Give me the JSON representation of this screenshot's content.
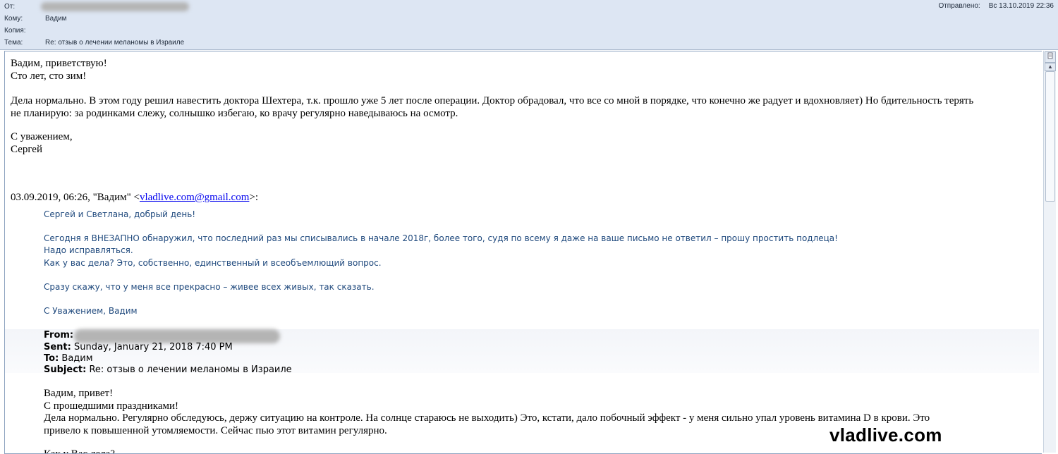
{
  "header": {
    "from_label": "От:",
    "to_label": "Кому:",
    "to_value": "Вадим",
    "cc_label": "Копия:",
    "subject_label": "Тема:",
    "subject_value": "Re: отзыв о лечении меланомы в Израиле",
    "sent_label": "Отправлено:",
    "sent_value": "Вс 13.10.2019 22:36"
  },
  "message": {
    "greeting": "Вадим, приветствую!",
    "line2": "Сто лет, сто зим!",
    "para1_line1": "Дела нормально. В этом году решил навестить доктора Шехтера, т.к. прошло уже 5 лет после операции. Доктор обрадовал, что все со мной в порядке, что конечно же радует и вдохновляет) Но бдительность терять",
    "para1_line2": "не планирую: за родинками слежу, солнышко избегаю, ко врачу регулярно наведываюсь на осмотр.",
    "closing": "С уважением,",
    "signature": "Сергей"
  },
  "quote1": {
    "header_prefix": "03.09.2019, 06:26, \"Вадим\" <",
    "header_email": "vladlive.com@gmail.com",
    "header_suffix": ">:",
    "l1": "Сергей и Светлана, добрый день!",
    "l2": "Сегодня я ВНЕЗАПНО обнаружил, что последний раз мы списывались в начале 2018г, более того, судя по всему я даже на ваше письмо не ответил – прошу простить подлеца!",
    "l3": "Надо исправляться.",
    "l4": "Как у вас дела? Это, собственно, единственный и всеобъемлющий вопрос.",
    "l5": "Сразу скажу, что у меня все прекрасно – живее всех живых, так сказать.",
    "l6": "С Уважением, Вадим"
  },
  "quote2": {
    "from_label": "From:",
    "sent_label": "Sent:",
    "sent_value": "Sunday, January 21, 2018 7:40 PM",
    "to_label": "To:",
    "to_value": "Вадим",
    "subject_label": "Subject:",
    "subject_value": "Re: отзыв о лечении меланомы в Израиле",
    "l1": "Вадим, привет!",
    "l2": "С прошедшими праздниками!",
    "l3": "Дела нормально. Регулярно обследуюсь, держу ситуацию на контроле. На солнце стараюсь не выходить) Это, кстати, дало побочный эффект - у меня сильно упал уровень витамина D в крови. Это",
    "l4": "привело к повышенной утомляемости. Сейчас пью этот витамин регулярно.",
    "l5": "Как у Вас дела?"
  },
  "watermark": "vladlive.com",
  "icons": {
    "scroll_up": "triangle-up-icon",
    "scroll_down": "triangle-down-icon",
    "corner": "page-icon"
  }
}
